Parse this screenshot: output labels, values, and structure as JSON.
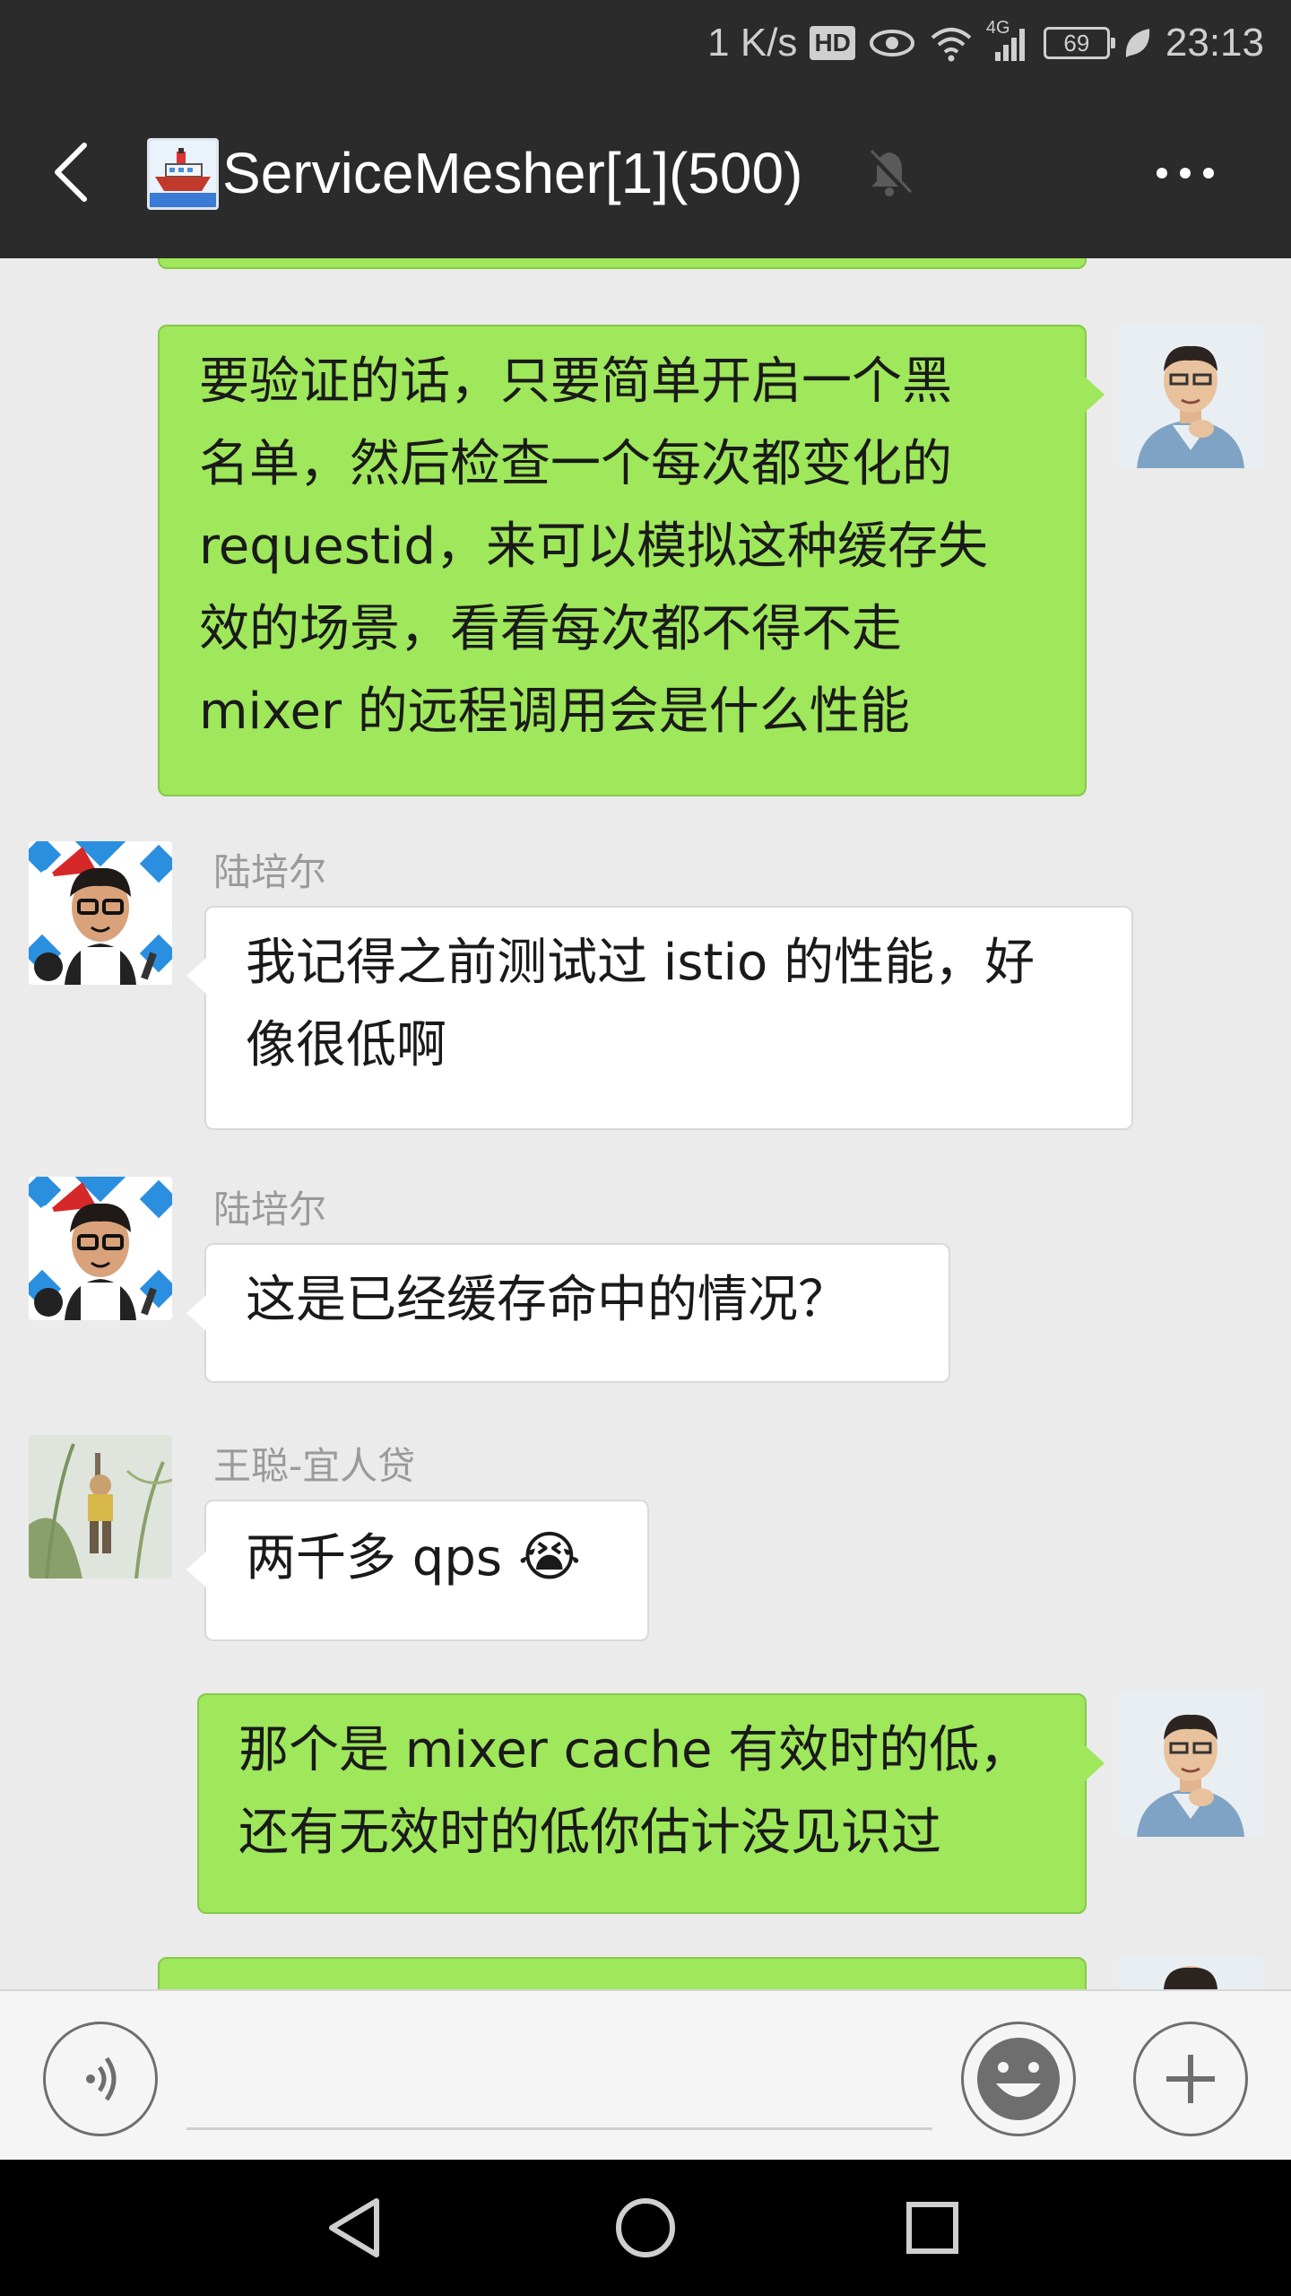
{
  "status_bar": {
    "speed": "1 K/s",
    "hd_badge": "HD",
    "network": "4G",
    "battery": "69",
    "time": "23:13"
  },
  "header": {
    "title": "ServiceMesher[1](500)"
  },
  "messages": [
    {
      "side": "right",
      "text": "要验证的话，只要简单开启一个黑\n名单，然后检查一个每次都变化的\nrequestid，来可以模拟这种缓存失\n效的场景，看看每次都不得不走\nmixer 的远程调用会是什么性能"
    },
    {
      "side": "left",
      "sender": "陆培尔",
      "text": "我记得之前测试过 istio 的性能，好\n像很低啊"
    },
    {
      "side": "left",
      "sender": "陆培尔",
      "text": "这是已经缓存命中的情况？"
    },
    {
      "side": "left",
      "sender": "王聪-宜人贷",
      "text": "两千多 qps ",
      "emoji": "😭"
    },
    {
      "side": "right",
      "text": "那个是 mixer cache 有效时的低，\n还有无效时的低你估计没见识过"
    }
  ],
  "colors": {
    "topbar": "#2b2b2b",
    "chat_bg": "#ebebeb",
    "my_bubble": "#9fe75b",
    "their_bubble": "#ffffff"
  },
  "icons": [
    "back-arrow-icon",
    "ship-group-avatar",
    "bell-muted-icon",
    "more-dots-icon",
    "voice-icon",
    "emoji-icon",
    "plus-icon",
    "triangle-back-icon",
    "circle-home-icon",
    "square-recents-icon"
  ]
}
